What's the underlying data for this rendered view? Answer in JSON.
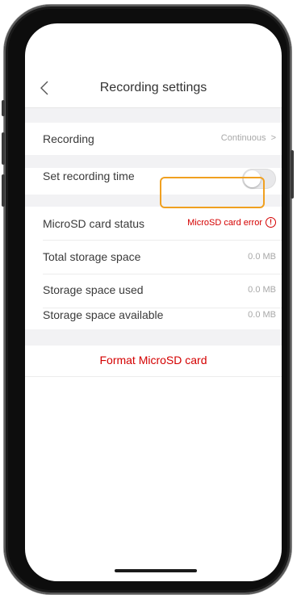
{
  "nav": {
    "title": "Recording settings"
  },
  "recording": {
    "label": "Recording",
    "value": "Continuous"
  },
  "schedule": {
    "label": "Set recording time",
    "enabled": false
  },
  "sd_status": {
    "label": "MicroSD card status",
    "value": "MicroSD card error"
  },
  "storage": [
    {
      "label": "Total storage space",
      "value": "0.0 MB"
    },
    {
      "label": "Storage space used",
      "value": "0.0 MB"
    },
    {
      "label": "Storage space available",
      "value": "0.0 MB"
    }
  ],
  "format_button": {
    "label": "Format MicroSD card"
  },
  "colors": {
    "accent_red": "#d40000",
    "highlight": "#f0a020"
  }
}
